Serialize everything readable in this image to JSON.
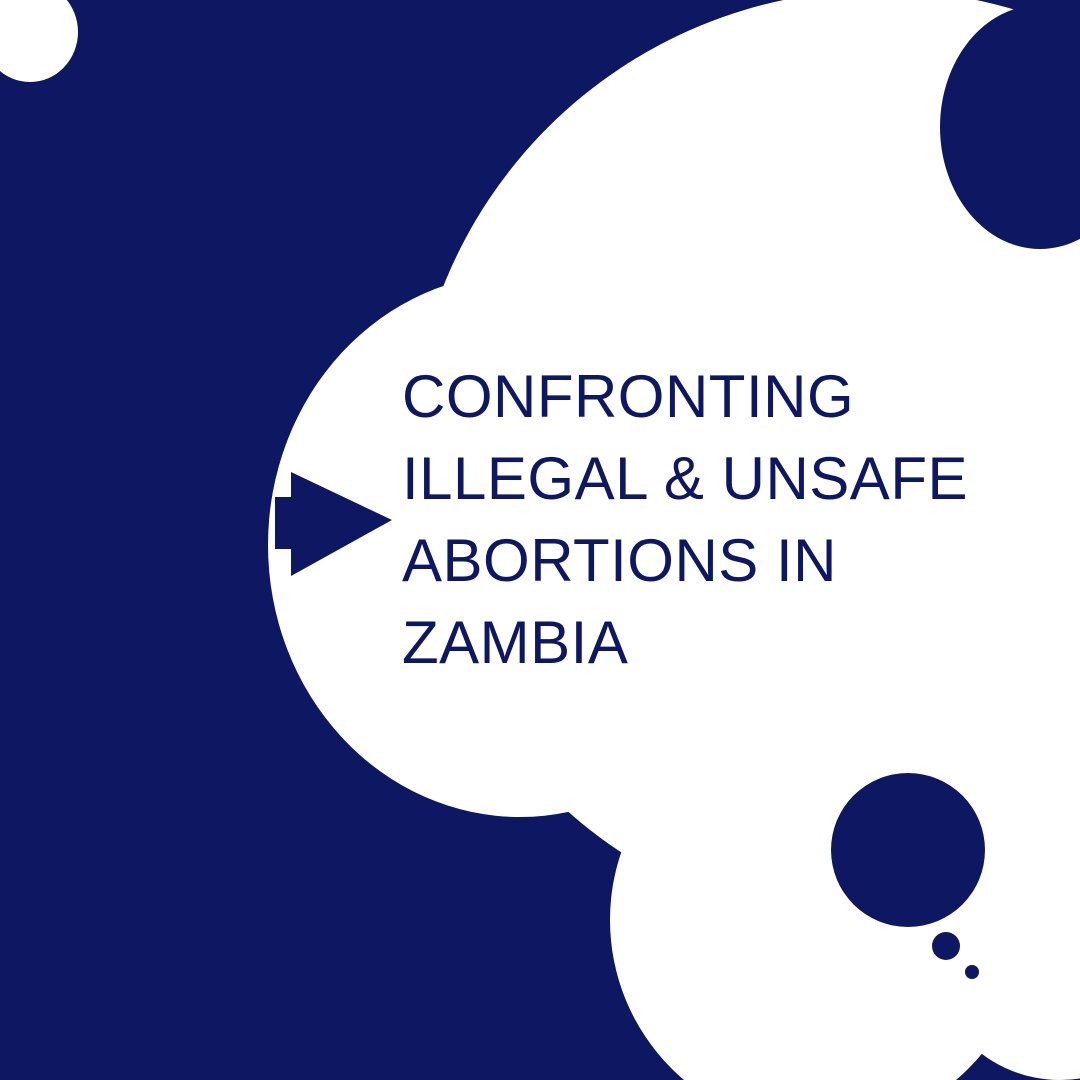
{
  "colors": {
    "background": "#0e1862",
    "bubble": "#ffffff",
    "text": "#0e1862"
  },
  "headline": {
    "lines": [
      "CONFRONTING",
      "ILLEGAL & UNSAFE",
      "ABORTIONS IN",
      "ZAMBIA"
    ]
  },
  "icons": {
    "pointer": "arrow-right-icon",
    "bubble": "thought-bubble-icon"
  }
}
